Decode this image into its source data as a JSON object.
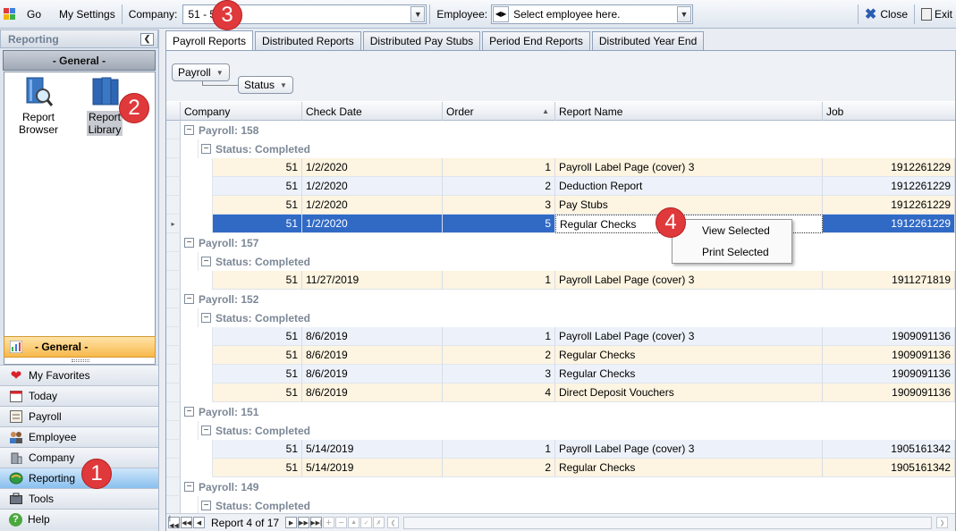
{
  "toolbar": {
    "go_label": "Go",
    "settings_label": "My Settings",
    "company_label": "Company:",
    "company_value": "51 - 51",
    "employee_label": "Employee:",
    "employee_placeholder": "Select employee here.",
    "close_label": "Close",
    "exit_label": "Exit"
  },
  "nav": {
    "header": "Reporting",
    "group_title": "- General -",
    "items": [
      {
        "label_line1": "Report",
        "label_line2": "Browser"
      },
      {
        "label_line1": "Report",
        "label_line2": "Library"
      }
    ],
    "active_group": "- General -",
    "sections": [
      {
        "label": "My Favorites",
        "icon": "heart-icon"
      },
      {
        "label": "Today",
        "icon": "calendar-icon"
      },
      {
        "label": "Payroll",
        "icon": "payroll-icon"
      },
      {
        "label": "Employee",
        "icon": "people-icon"
      },
      {
        "label": "Company",
        "icon": "building-icon"
      },
      {
        "label": "Reporting",
        "icon": "globe-icon"
      },
      {
        "label": "Tools",
        "icon": "tools-icon"
      },
      {
        "label": "Help",
        "icon": "help-icon"
      }
    ]
  },
  "tabs": [
    "Payroll Reports",
    "Distributed Reports",
    "Distributed Pay Stubs",
    "Period End Reports",
    "Distributed Year End"
  ],
  "grouping": {
    "chip1": "Payroll",
    "chip2": "Status"
  },
  "columns": [
    "Company",
    "Check Date",
    "Order",
    "Report Name",
    "Job"
  ],
  "groups": [
    {
      "payroll": "Payroll: 158",
      "status": "Status: Completed",
      "rows": [
        {
          "company": "51",
          "date": "1/2/2020",
          "order": "1",
          "name": "Payroll Label Page (cover) 3",
          "job": "1912261229"
        },
        {
          "company": "51",
          "date": "1/2/2020",
          "order": "2",
          "name": "Deduction Report",
          "job": "1912261229"
        },
        {
          "company": "51",
          "date": "1/2/2020",
          "order": "3",
          "name": "Pay Stubs",
          "job": "1912261229"
        },
        {
          "company": "51",
          "date": "1/2/2020",
          "order": "5",
          "name": "Regular Checks",
          "job": "1912261229"
        }
      ]
    },
    {
      "payroll": "Payroll: 157",
      "status": "Status: Completed",
      "rows": [
        {
          "company": "51",
          "date": "11/27/2019",
          "order": "1",
          "name": "Payroll Label Page (cover) 3",
          "job": "1911271819"
        }
      ]
    },
    {
      "payroll": "Payroll: 152",
      "status": "Status: Completed",
      "rows": [
        {
          "company": "51",
          "date": "8/6/2019",
          "order": "1",
          "name": "Payroll Label Page (cover) 3",
          "job": "1909091136"
        },
        {
          "company": "51",
          "date": "8/6/2019",
          "order": "2",
          "name": "Regular Checks",
          "job": "1909091136"
        },
        {
          "company": "51",
          "date": "8/6/2019",
          "order": "3",
          "name": "Regular Checks",
          "job": "1909091136"
        },
        {
          "company": "51",
          "date": "8/6/2019",
          "order": "4",
          "name": "Direct Deposit Vouchers",
          "job": "1909091136"
        }
      ]
    },
    {
      "payroll": "Payroll: 151",
      "status": "Status: Completed",
      "rows": [
        {
          "company": "51",
          "date": "5/14/2019",
          "order": "1",
          "name": "Payroll Label Page (cover) 3",
          "job": "1905161342"
        },
        {
          "company": "51",
          "date": "5/14/2019",
          "order": "2",
          "name": "Regular Checks",
          "job": "1905161342"
        }
      ]
    },
    {
      "payroll": "Payroll: 149",
      "status": "Status: Completed",
      "rows": []
    }
  ],
  "context_menu": [
    "View Selected",
    "Print Selected"
  ],
  "footer": {
    "record_text": "Report 4 of 17"
  },
  "callouts": [
    "1",
    "2",
    "3",
    "4"
  ],
  "colors": {
    "selection": "#316ac5",
    "callout": "#e0393b",
    "odd_row": "#fdf4e1",
    "even_row": "#edf2fa"
  }
}
